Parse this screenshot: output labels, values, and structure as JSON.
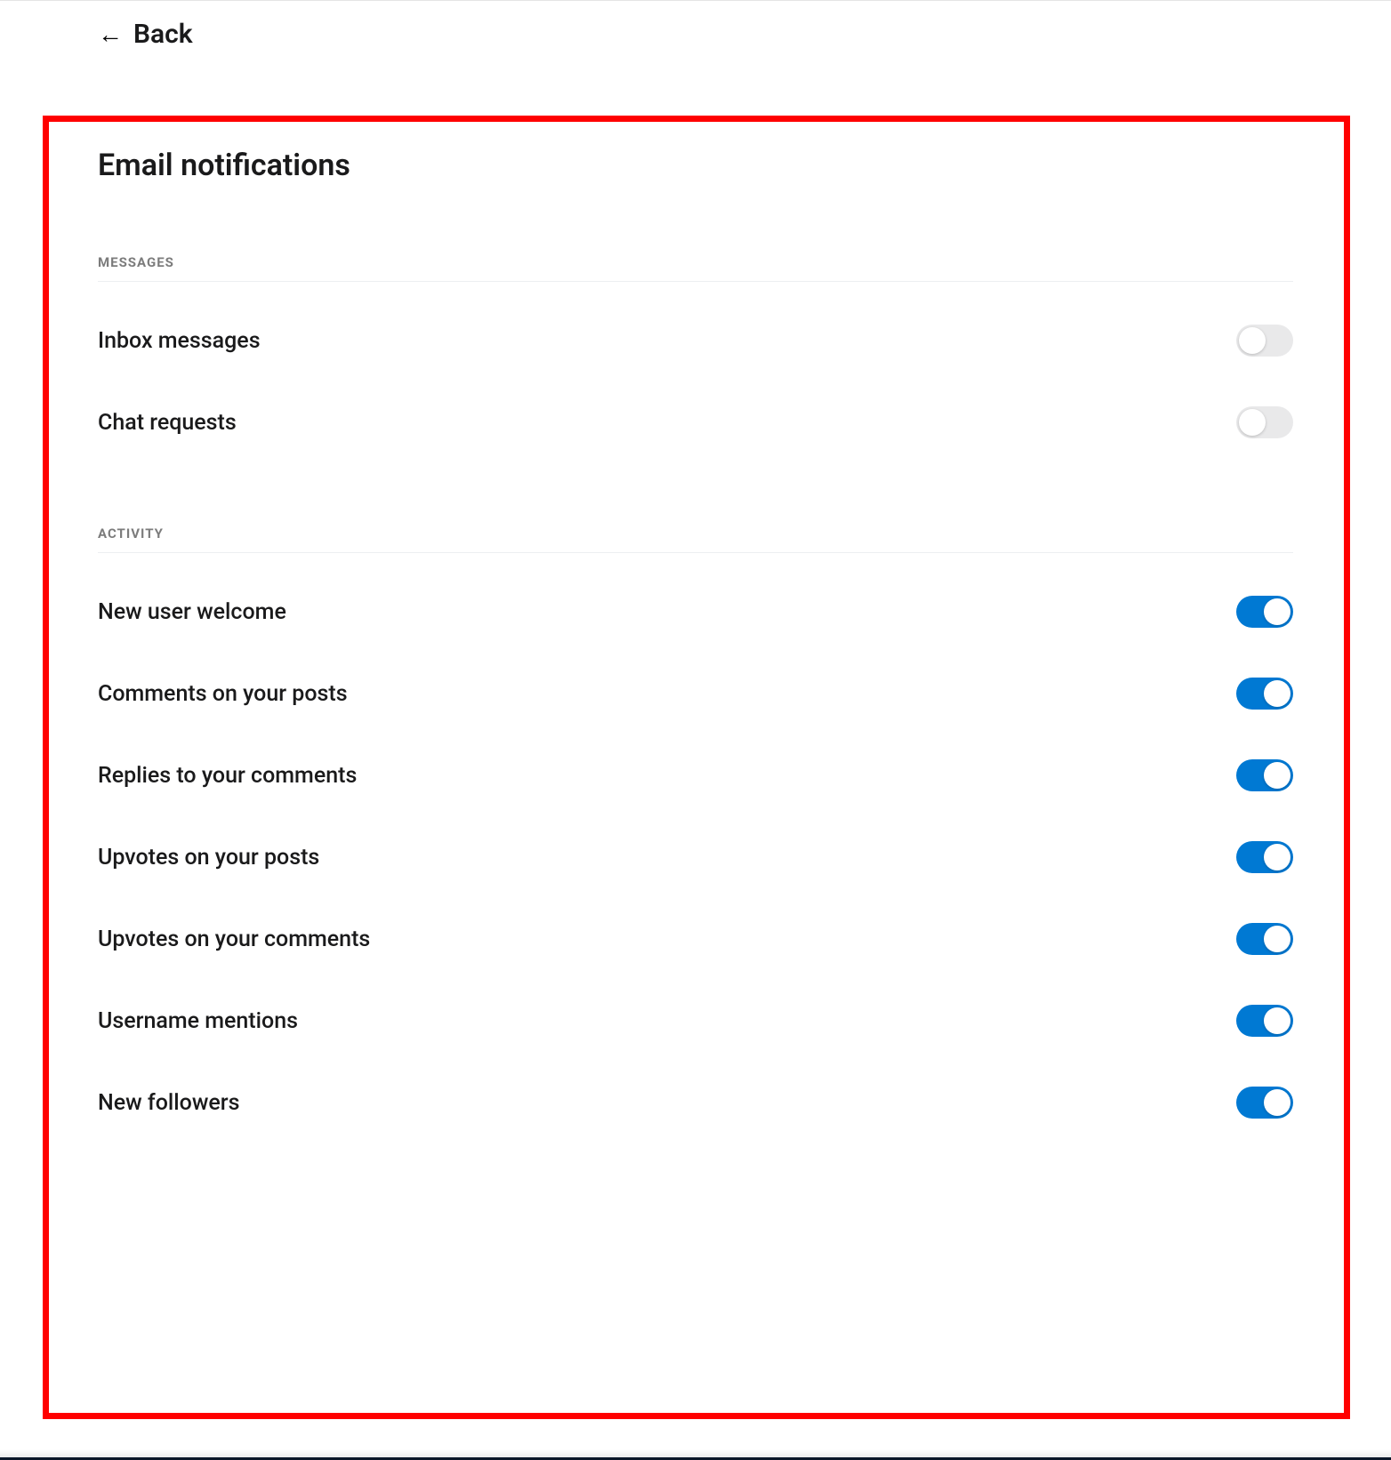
{
  "nav": {
    "back_label": "Back"
  },
  "page": {
    "title": "Email notifications"
  },
  "sections": {
    "messages": {
      "header": "MESSAGES",
      "items": {
        "inbox_messages": {
          "label": "Inbox messages",
          "enabled": false
        },
        "chat_requests": {
          "label": "Chat requests",
          "enabled": false
        }
      }
    },
    "activity": {
      "header": "ACTIVITY",
      "items": {
        "new_user_welcome": {
          "label": "New user welcome",
          "enabled": true
        },
        "comments_on_posts": {
          "label": "Comments on your posts",
          "enabled": true
        },
        "replies_to_comments": {
          "label": "Replies to your comments",
          "enabled": true
        },
        "upvotes_on_posts": {
          "label": "Upvotes on your posts",
          "enabled": true
        },
        "upvotes_on_comments": {
          "label": "Upvotes on your comments",
          "enabled": true
        },
        "username_mentions": {
          "label": "Username mentions",
          "enabled": true
        },
        "new_followers": {
          "label": "New followers",
          "enabled": true
        }
      }
    }
  }
}
